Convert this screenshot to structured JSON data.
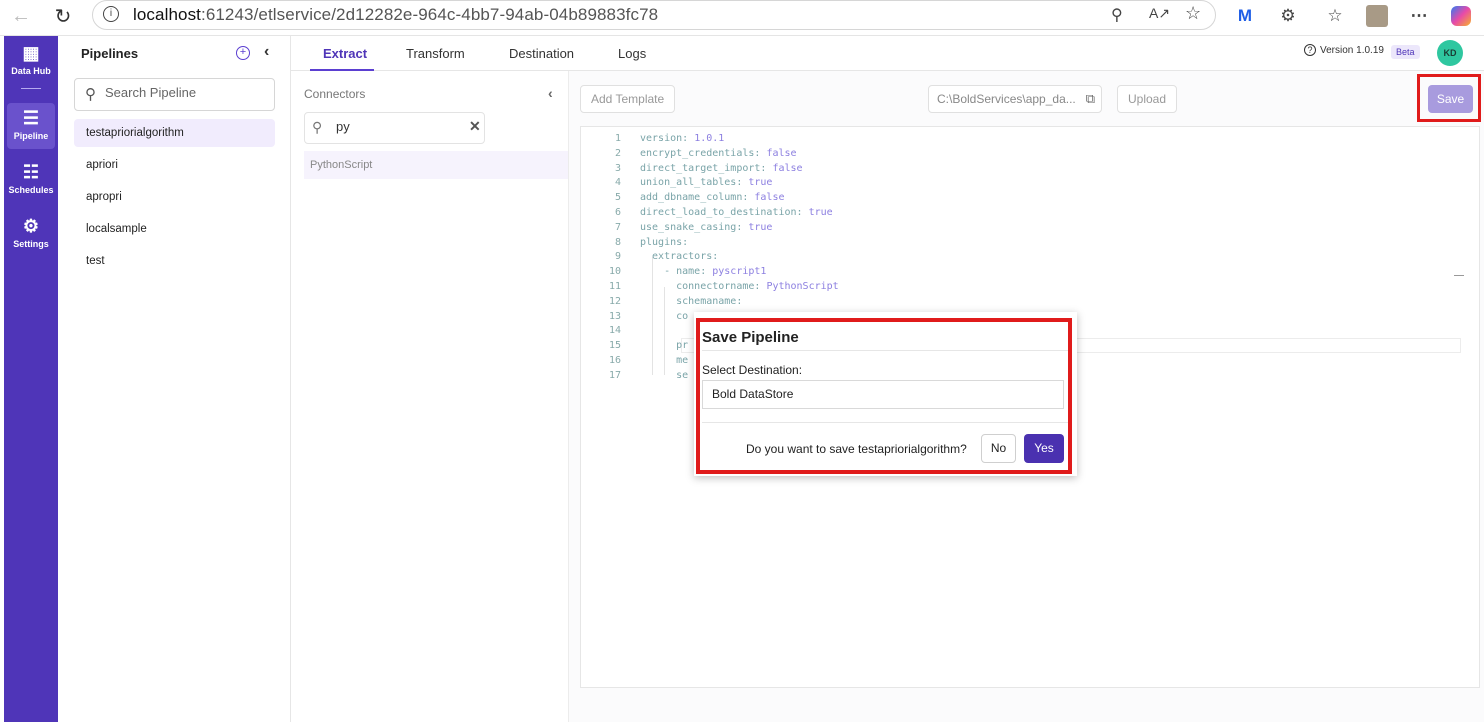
{
  "browser": {
    "url_host": "localhost",
    "url_path": ":61243/etlservice/2d12282e-964c-4bb7-94ab-04b89883fc78"
  },
  "rail": {
    "items": [
      {
        "label": "Data Hub",
        "icon": "data-hub-icon"
      },
      {
        "label": "Pipeline",
        "icon": "layers-icon"
      },
      {
        "label": "Schedules",
        "icon": "calendar-icon"
      },
      {
        "label": "Settings",
        "icon": "gear-icon"
      }
    ]
  },
  "pipelines": {
    "title": "Pipelines",
    "search_placeholder": "Search Pipeline",
    "items": [
      "testapriorialgorithm",
      "apriori",
      "apropri",
      "localsample",
      "test"
    ]
  },
  "tabs": [
    "Extract",
    "Transform",
    "Destination",
    "Logs"
  ],
  "header": {
    "version": "Version 1.0.19",
    "beta": "Beta",
    "avatar": "KD"
  },
  "connectors": {
    "title": "Connectors",
    "search_value": "py",
    "items": [
      "PythonScript"
    ]
  },
  "toolbar": {
    "add_template": "Add Template",
    "path": "C:\\BoldServices\\app_da...",
    "upload": "Upload",
    "save": "Save"
  },
  "editor": {
    "lines": [
      {
        "n": "1",
        "k": "version: ",
        "v": "1.0.1"
      },
      {
        "n": "2",
        "k": "encrypt_credentials: ",
        "v": "false"
      },
      {
        "n": "3",
        "k": "direct_target_import: ",
        "v": "false"
      },
      {
        "n": "4",
        "k": "union_all_tables: ",
        "v": "true"
      },
      {
        "n": "5",
        "k": "add_dbname_column: ",
        "v": "false"
      },
      {
        "n": "6",
        "k": "direct_load_to_destination: ",
        "v": "true"
      },
      {
        "n": "7",
        "k": "use_snake_casing: ",
        "v": "true"
      },
      {
        "n": "8",
        "k": "plugins:",
        "v": ""
      },
      {
        "n": "9",
        "k": "  extractors:",
        "v": ""
      },
      {
        "n": "10",
        "k": "    - name: ",
        "v": "pyscript1"
      },
      {
        "n": "11",
        "k": "      connectorname: ",
        "v": "PythonScript"
      },
      {
        "n": "12",
        "k": "      schemaname:",
        "v": ""
      },
      {
        "n": "13",
        "k": "      co",
        "v": ""
      },
      {
        "n": "14",
        "k": "",
        "v": ""
      },
      {
        "n": "15",
        "k": "      pr",
        "v": ""
      },
      {
        "n": "16",
        "k": "      me",
        "v": ""
      },
      {
        "n": "17",
        "k": "      se",
        "v": ""
      }
    ]
  },
  "modal": {
    "title": "Save Pipeline",
    "label": "Select Destination:",
    "selected": "Bold DataStore",
    "question": "Do you want to save testapriorialgorithm?",
    "no": "No",
    "yes": "Yes"
  },
  "colors": {
    "accent": "#4f35b8",
    "highlight": "#e01b1b"
  }
}
